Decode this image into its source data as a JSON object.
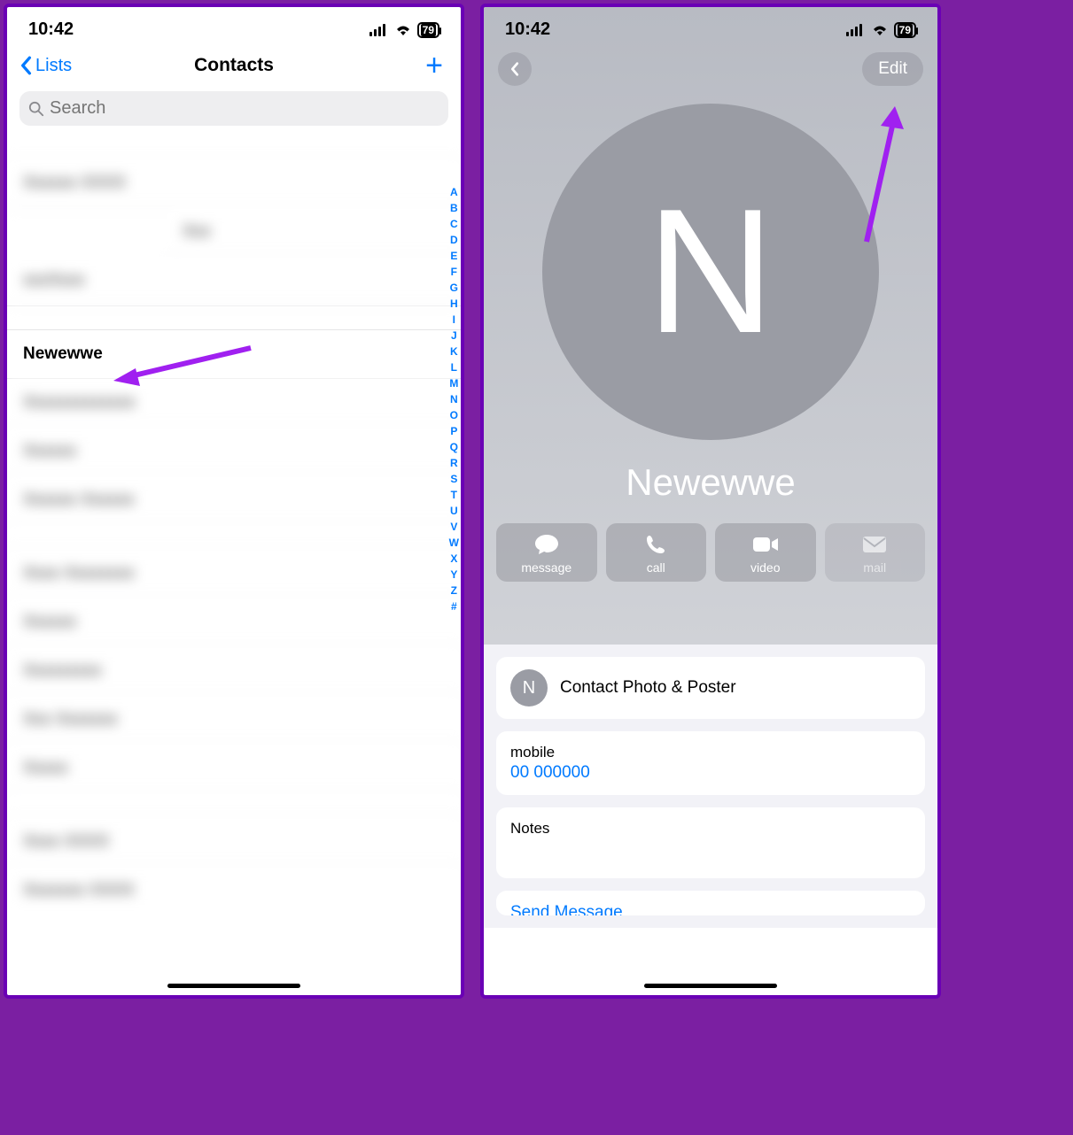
{
  "status": {
    "time": "10:42",
    "battery": "79"
  },
  "left": {
    "back_label": "Lists",
    "title": "Contacts",
    "search_placeholder": "Search",
    "highlighted_contact": "Newewwe",
    "index_letters": [
      "A",
      "B",
      "C",
      "D",
      "E",
      "F",
      "G",
      "H",
      "I",
      "J",
      "K",
      "L",
      "M",
      "N",
      "O",
      "P",
      "Q",
      "R",
      "S",
      "T",
      "U",
      "V",
      "W",
      "X",
      "Y",
      "Z",
      "#"
    ]
  },
  "right": {
    "edit_label": "Edit",
    "avatar_letter": "N",
    "contact_name": "Newewwe",
    "actions": {
      "message": "message",
      "call": "call",
      "video": "video",
      "mail": "mail"
    },
    "photo_poster": "Contact Photo & Poster",
    "mini_avatar_letter": "N",
    "mobile_label": "mobile",
    "mobile_value": "00 000000",
    "notes_label": "Notes",
    "send_message": "Send Message"
  }
}
